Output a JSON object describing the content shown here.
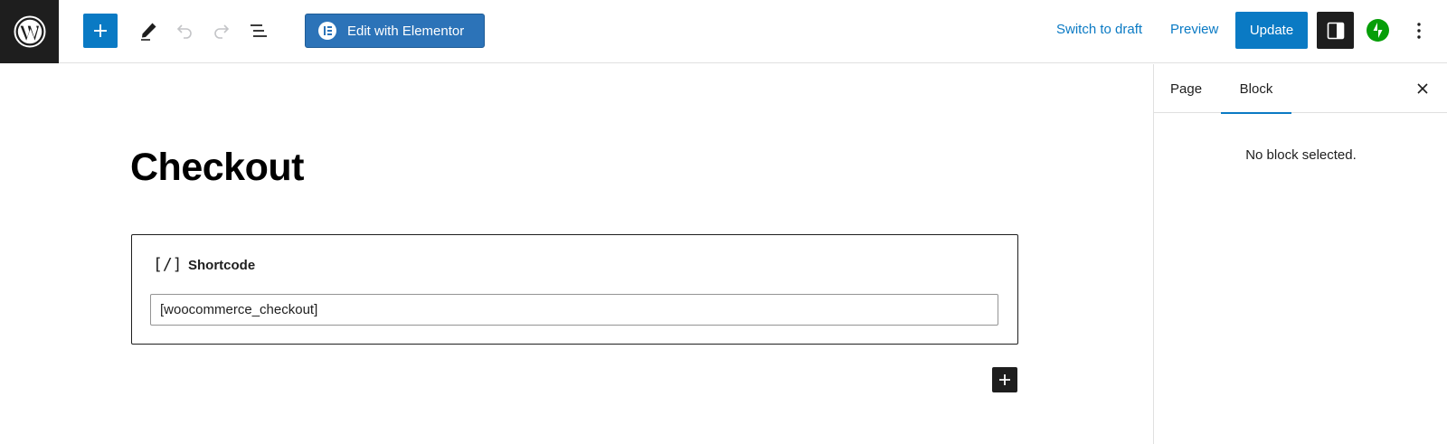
{
  "header": {
    "logo_icon": "wordpress-logo-icon",
    "toolbar": {
      "add_icon": "plus-icon",
      "tools_icon": "pen-icon",
      "undo_icon": "undo-icon",
      "redo_icon": "redo-icon",
      "list_view_icon": "list-view-icon"
    },
    "elementor_button_label": "Edit with Elementor",
    "switch_to_draft_label": "Switch to draft",
    "preview_label": "Preview",
    "update_label": "Update",
    "settings_icon": "sidebar-toggle-icon",
    "jetpack_icon": "jetpack-icon",
    "more_icon": "more-vertical-icon"
  },
  "editor": {
    "title": "Checkout",
    "block": {
      "icon_text": "[/]",
      "label": "Shortcode",
      "value": "[woocommerce_checkout]"
    },
    "inserter_icon": "plus-icon"
  },
  "sidebar": {
    "tabs": [
      {
        "label": "Page",
        "active": false
      },
      {
        "label": "Block",
        "active": true
      }
    ],
    "close_icon": "close-icon",
    "empty_message": "No block selected."
  },
  "colors": {
    "accent": "#0a7ac4",
    "elementor": "#2c73b8",
    "dark": "#1e1e1e",
    "jetpack": "#069e08"
  }
}
